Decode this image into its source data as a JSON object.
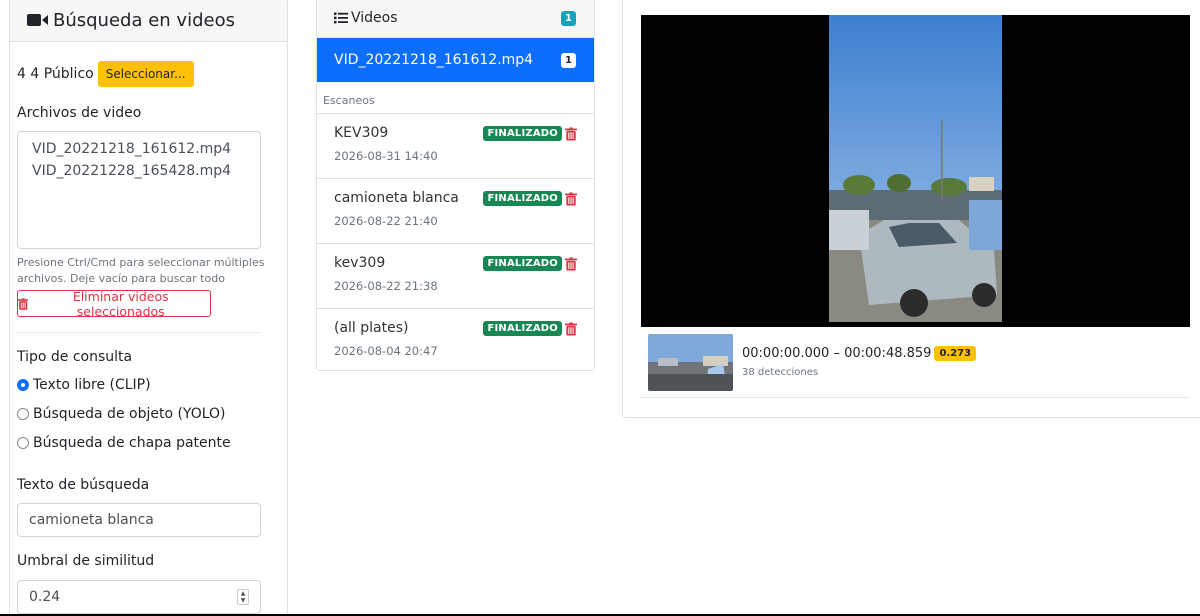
{
  "sidebar": {
    "title": "Búsqueda en videos",
    "owner_text": "4 4 Público",
    "select_button": "Seleccionar...",
    "files_label": "Archivos de video",
    "files": [
      "VID_20221218_161612.mp4",
      "VID_20221228_165428.mp4"
    ],
    "files_help": "Presione Ctrl/Cmd para seleccionar múltiples archivos. Deje vacío para buscar todo",
    "delete_button": "Eliminar videos seleccionados",
    "query_type_label": "Tipo de consulta",
    "query_types": [
      {
        "label": "Texto libre (CLIP)",
        "checked": true
      },
      {
        "label": "Búsqueda de objeto (YOLO)",
        "checked": false
      },
      {
        "label": "Búsqueda de chapa patente",
        "checked": false
      }
    ],
    "search_text_label": "Texto de búsqueda",
    "search_text_value": "camioneta blanca",
    "threshold_label": "Umbral de similitud",
    "threshold_value": "0.24"
  },
  "videos_panel": {
    "title": "Videos",
    "count": "1",
    "active_video": {
      "name": "VID_20221218_161612.mp4",
      "count": "1"
    },
    "scans_label": "Escaneos",
    "scans": [
      {
        "name": "KEV309",
        "date": "2026-08-31 14:40",
        "status": "FINALIZADO"
      },
      {
        "name": "camioneta blanca",
        "date": "2026-08-22 21:40",
        "status": "FINALIZADO"
      },
      {
        "name": "kev309",
        "date": "2026-08-22 21:38",
        "status": "FINALIZADO"
      },
      {
        "name": "(all plates)",
        "date": "2026-08-04 20:47",
        "status": "FINALIZADO"
      }
    ]
  },
  "result": {
    "time_range": "00:00:00.000 – 00:00:48.859",
    "score": "0.273",
    "detections": "38 detecciones"
  },
  "colors": {
    "primary": "#0d6efd",
    "success": "#198754",
    "warning": "#ffc107",
    "danger": "#dc3545",
    "info": "#17a2b8"
  }
}
